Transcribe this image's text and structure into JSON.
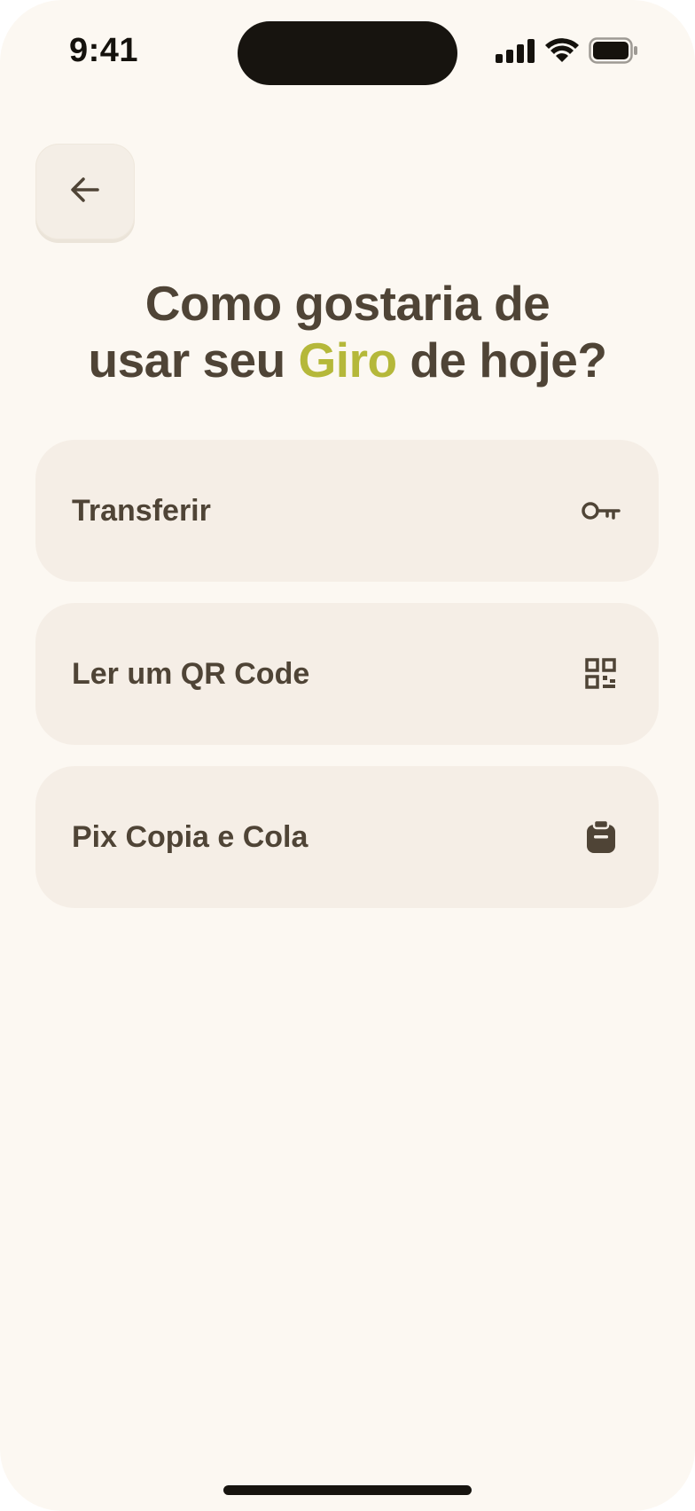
{
  "status_bar": {
    "time": "9:41",
    "signal_icon": "cellular-signal-icon",
    "wifi_icon": "wifi-icon",
    "battery_icon": "battery-icon"
  },
  "back_button": {
    "icon": "arrow-left-icon"
  },
  "heading": {
    "line1": "Como gostaria de",
    "line2_before": "usar seu ",
    "line2_accent": "Giro",
    "line2_after": " de hoje?"
  },
  "options": [
    {
      "label": "Transferir",
      "icon": "key-icon"
    },
    {
      "label": "Ler um QR Code",
      "icon": "qr-code-icon"
    },
    {
      "label": "Pix Copia e Cola",
      "icon": "clipboard-icon"
    }
  ],
  "colors": {
    "background": "#fcf8f2",
    "card": "#f5eee6",
    "text": "#4f4436",
    "accent": "#b5b83a"
  }
}
